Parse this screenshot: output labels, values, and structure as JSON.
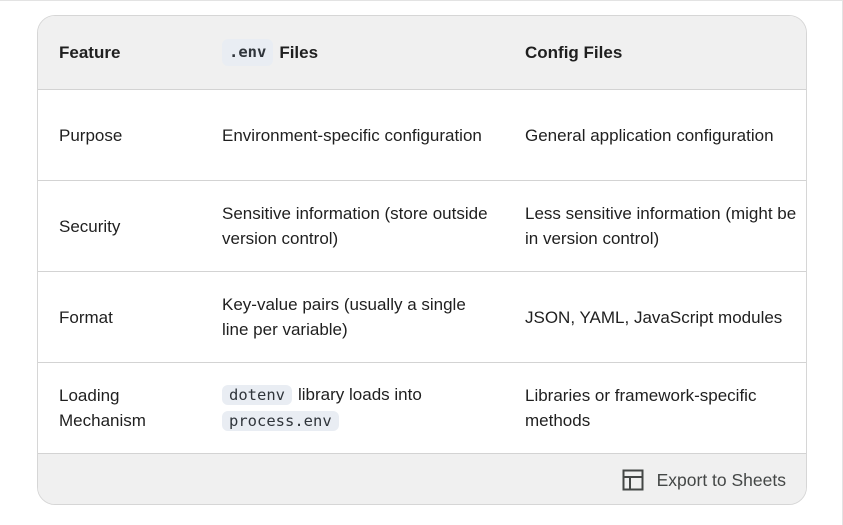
{
  "table": {
    "headers": {
      "feature": "Feature",
      "env_chip": ".env",
      "env_files": "Files",
      "config_files": "Config Files"
    },
    "rows": [
      {
        "feature": "Purpose",
        "env": "Environment-specific configuration",
        "config": "General application configuration"
      },
      {
        "feature": "Security",
        "env": "Sensitive information (store outside version control)",
        "config": "Less sensitive information (might be in version control)"
      },
      {
        "feature": "Format",
        "env": "Key-value pairs (usually a single line per variable)",
        "config": "JSON, YAML, JavaScript modules"
      },
      {
        "feature": "Loading Mechanism",
        "env_chip_1": "dotenv",
        "env_text": "library loads into",
        "env_chip_2": "process.env",
        "config": "Libraries or framework-specific methods"
      }
    ]
  },
  "footer": {
    "export_label": "Export to Sheets",
    "icon": "sheets-table-icon"
  }
}
